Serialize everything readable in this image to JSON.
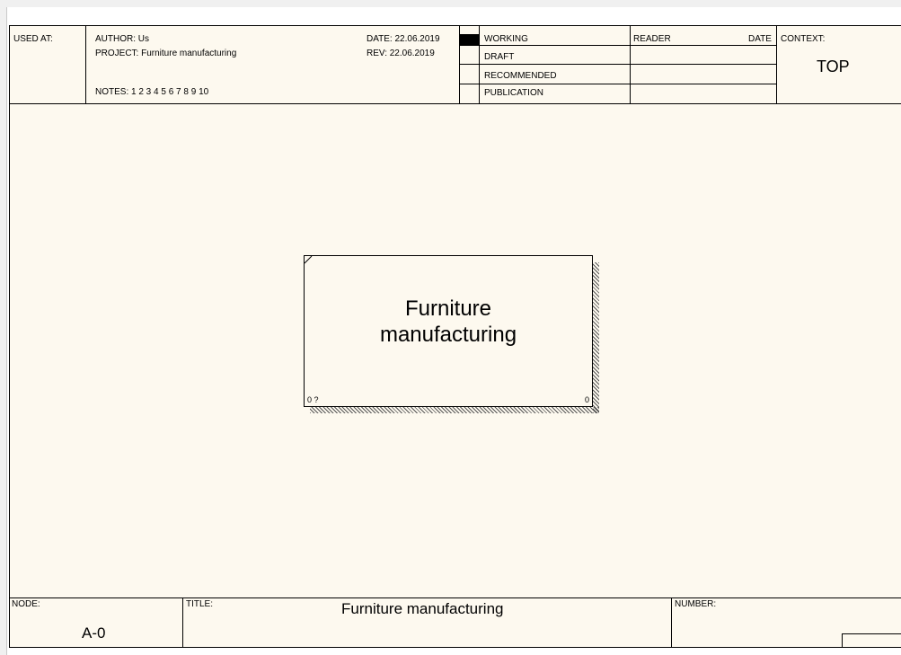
{
  "header": {
    "used_at_label": "USED AT:",
    "author": "AUTHOR:  Us",
    "project": "PROJECT:  Furniture manufacturing",
    "notes": "NOTES:  1  2  3  4  5  6  7  8  9  10",
    "date": "DATE:  22.06.2019",
    "rev": "REV:   22.06.2019",
    "status": [
      "WORKING",
      "DRAFT",
      "RECOMMENDED",
      "PUBLICATION"
    ],
    "reader_label": "READER",
    "reader_date_label": "DATE",
    "context_label": "CONTEXT:",
    "context_value": "TOP"
  },
  "activity": {
    "title_line1": "Furniture",
    "title_line2": "manufacturing",
    "number_left": "0 ?",
    "number_right": "0"
  },
  "footer": {
    "node_label": "NODE:",
    "node_value": "A-0",
    "title_label": "TITLE:",
    "title_value": "Furniture manufacturing",
    "number_label": "NUMBER:"
  }
}
